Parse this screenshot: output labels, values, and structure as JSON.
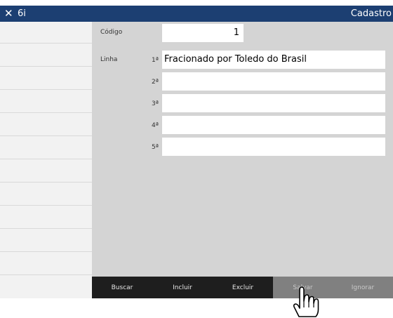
{
  "window": {
    "close_glyph": "✕",
    "title": "6i",
    "right_title": "Cadastro"
  },
  "form": {
    "codigo_label": "Código",
    "codigo_value": "1",
    "linha_label": "Linha",
    "lines": [
      {
        "ordinal": "1ª",
        "value": "Fracionado por Toledo do Brasil"
      },
      {
        "ordinal": "2ª",
        "value": ""
      },
      {
        "ordinal": "3ª",
        "value": ""
      },
      {
        "ordinal": "4ª",
        "value": ""
      },
      {
        "ordinal": "5ª",
        "value": ""
      }
    ]
  },
  "buttons": [
    {
      "label": "Buscar",
      "enabled": true
    },
    {
      "label": "Incluir",
      "enabled": true
    },
    {
      "label": "Excluir",
      "enabled": true
    },
    {
      "label": "Salvar",
      "enabled": false
    },
    {
      "label": "Ignorar",
      "enabled": false
    }
  ],
  "colors": {
    "titlebar": "#1c3f72",
    "button_dark": "#1e1e1e",
    "button_disabled": "#808080",
    "panel": "#d4d4d4"
  },
  "icons": {
    "close": "close-icon",
    "cursor": "hand-pointer-icon"
  }
}
